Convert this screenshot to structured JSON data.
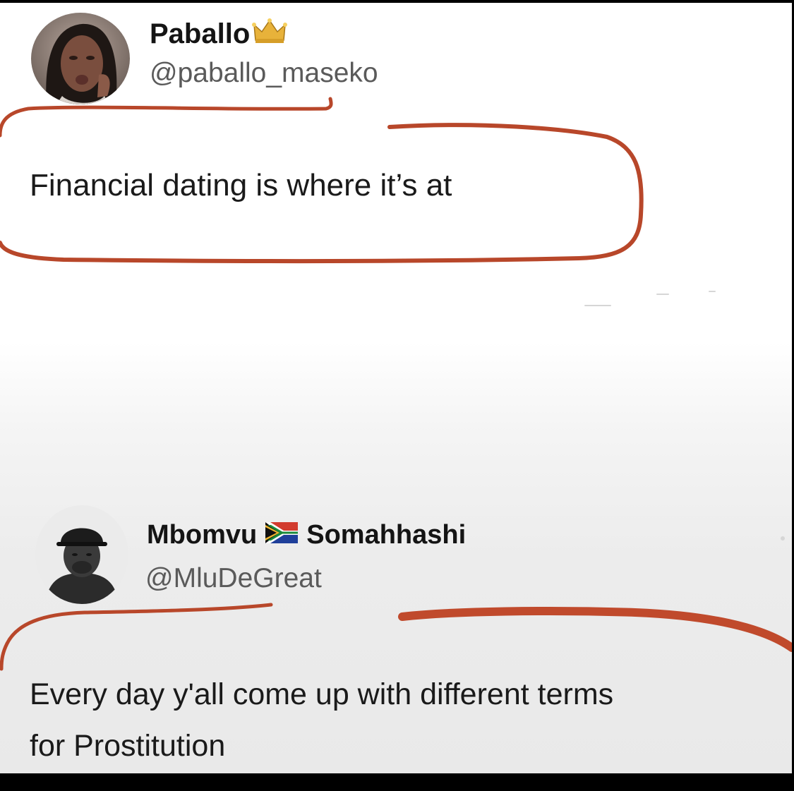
{
  "first_post": {
    "display_name": "Paballo",
    "name_emoji": "crown-icon",
    "handle": "@paballo_maseko",
    "text": "Financial dating is where it’s at"
  },
  "reply_post": {
    "display_name_first": "Mbomvu",
    "flag_emoji": "south-africa-flag-icon",
    "display_name_second": "Somahhashi",
    "handle": "@MluDeGreat",
    "text": "Every day y'all come up with different terms\nfor Prostitution"
  },
  "colors": {
    "marker": "#b8472a",
    "crown": "#e8b23a",
    "text": "#1a1a1a",
    "handle": "#5a5a5a"
  }
}
